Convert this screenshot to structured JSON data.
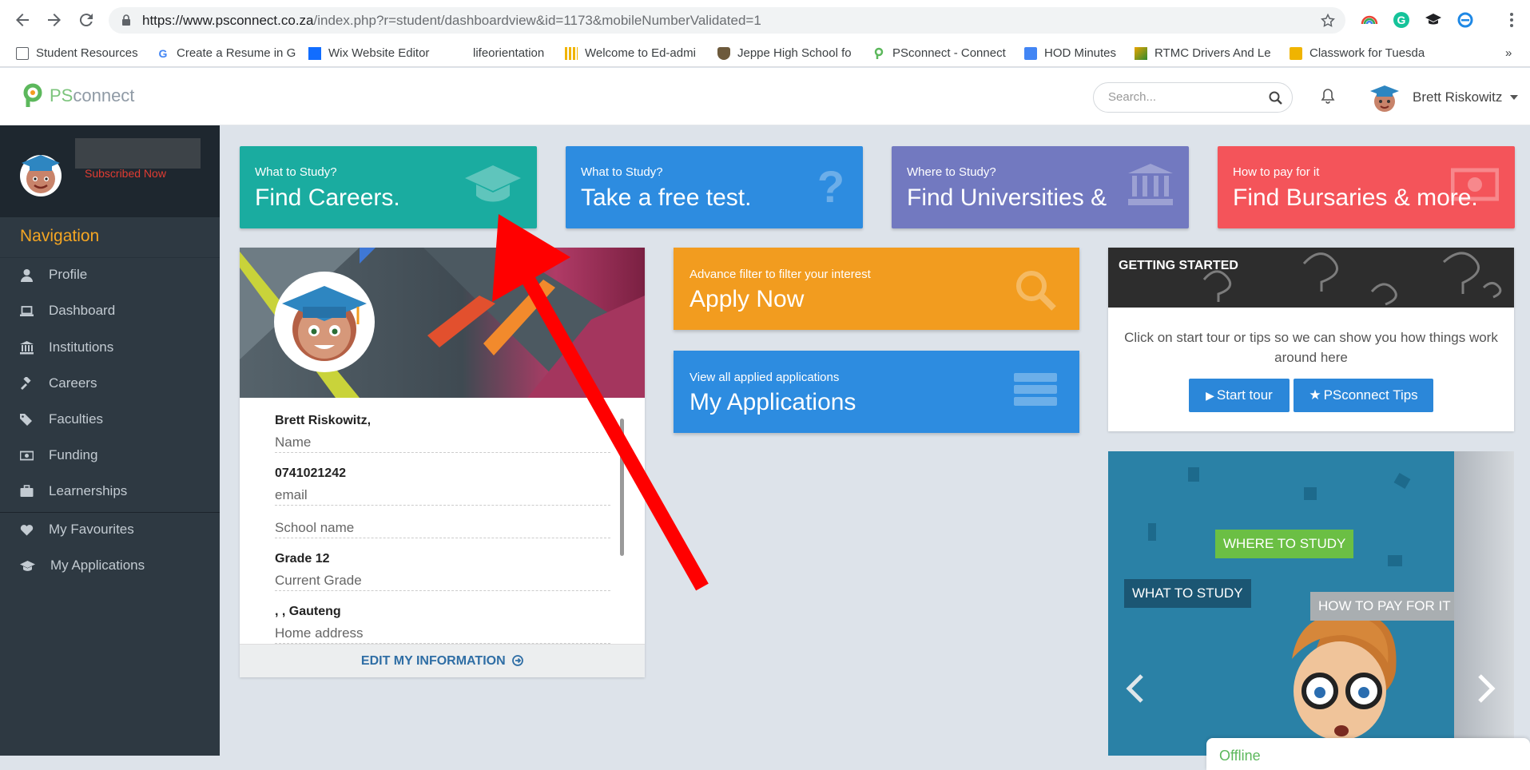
{
  "browser": {
    "url_host": "https://www.psconnect.co.za",
    "url_path": "/index.php?r=student/dashboardview&id=1173&mobileNumberValidated=1",
    "bookmarks": [
      {
        "label": "Student Resources"
      },
      {
        "label": "Create a Resume in G"
      },
      {
        "label": "Wix Website Editor"
      },
      {
        "label": "lifeorientation"
      },
      {
        "label": "Welcome to Ed-admi"
      },
      {
        "label": "Jeppe High School fo"
      },
      {
        "label": "PSconnect - Connect"
      },
      {
        "label": "HOD Minutes"
      },
      {
        "label": "RTMC Drivers And Le"
      },
      {
        "label": "Classwork for Tuesda"
      }
    ],
    "more": "»"
  },
  "header": {
    "logo_ps": "PS",
    "logo_connect": "connect",
    "search_placeholder": "Search...",
    "user_name": "Brett Riskowitz"
  },
  "sidebar": {
    "subscribed": "Subscribed Now",
    "nav_title": "Navigation",
    "items": [
      {
        "label": "Profile",
        "icon": "user-icon"
      },
      {
        "label": "Dashboard",
        "icon": "laptop-icon"
      },
      {
        "label": "Institutions",
        "icon": "bank-icon"
      },
      {
        "label": "Careers",
        "icon": "gavel-icon"
      },
      {
        "label": "Faculties",
        "icon": "tags-icon"
      },
      {
        "label": "Funding",
        "icon": "money-icon"
      },
      {
        "label": "Learnerships",
        "icon": "briefcase-icon"
      }
    ],
    "items2": [
      {
        "label": "My Favourites",
        "icon": "heart-icon"
      },
      {
        "label": "My Applications",
        "icon": "graduation-cap-icon"
      }
    ]
  },
  "tiles": [
    {
      "small": "What to Study?",
      "large": "Find Careers.",
      "color": "#1aaca0",
      "icon": "graduation-cap-icon"
    },
    {
      "small": "What to Study?",
      "large": "Take a free test.",
      "color": "#2d8ce0",
      "icon": "question-icon"
    },
    {
      "small": "Where to Study?",
      "large": "Find Universities &",
      "color": "#7279c0",
      "icon": "bank-icon"
    },
    {
      "small": "How to pay for it",
      "large": "Find Bursaries & more.",
      "color": "#f4545a",
      "icon": "money-icon"
    }
  ],
  "profile": {
    "fields": [
      {
        "value": "Brett Riskowitz,",
        "label": "Name"
      },
      {
        "value": "0741021242",
        "label": "email"
      },
      {
        "value": "",
        "label": "School name"
      },
      {
        "value": "Grade 12",
        "label": "Current Grade"
      },
      {
        "value": ", , Gauteng",
        "label": "Home address"
      }
    ],
    "edit_label": "EDIT MY INFORMATION"
  },
  "actions": [
    {
      "small": "Advance filter to filter your interest",
      "large": "Apply Now",
      "color": "#f29c1f",
      "icon": "search-icon"
    },
    {
      "small": "View all applied applications",
      "large": "My Applications",
      "color": "#2d8ce0",
      "icon": "list-icon"
    }
  ],
  "getting_started": {
    "title": "GETTING STARTED",
    "text": "Click on start tour or tips so we can show you how things work around here",
    "start_tour": "Start tour",
    "tips": "PSconnect Tips"
  },
  "carousel": {
    "where": "WHERE TO STUDY",
    "what": "WHAT TO STUDY",
    "how": "HOW TO PAY FOR IT"
  },
  "chat": {
    "status": "Offline"
  }
}
